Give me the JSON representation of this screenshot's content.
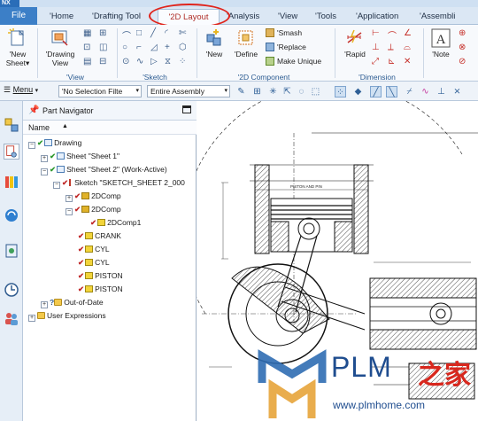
{
  "app": {
    "logo": "NX"
  },
  "tabs": [
    {
      "label": "File"
    },
    {
      "label": "'Home"
    },
    {
      "label": "'Drafting Tool"
    },
    {
      "label": "'2D Layout"
    },
    {
      "label": "'Analysis"
    },
    {
      "label": "'View"
    },
    {
      "label": "'Tools"
    },
    {
      "label": "'Application"
    },
    {
      "label": "'Assembli"
    }
  ],
  "ribbon": {
    "new_sheet": "'New\nSheet",
    "new_sheet_dropdown": "▾",
    "drawing_view": "'Drawing\nView",
    "new": "'New",
    "define": "'Define",
    "smash": "'Smash",
    "replace": "'Replace",
    "make_unique": "Make Unique",
    "rapid": "'Rapid",
    "note": "'Note",
    "groups": {
      "view": "'View",
      "sketch": "'Sketch",
      "component": "'2D Component",
      "dimension": "'Dimension"
    }
  },
  "cmdbar": {
    "menu": "Menu",
    "selection_filter": "'No Selection Filte",
    "assembly_scope": "Entire Assembly"
  },
  "navigator": {
    "title": "Part Navigator",
    "column_name": "Name",
    "nodes": [
      {
        "label": "Drawing"
      },
      {
        "label": "Sheet \"Sheet 1\""
      },
      {
        "label": "Sheet \"Sheet 2\" (Work-Active)"
      },
      {
        "label": "Sketch \"SKETCH_SHEET 2_000"
      },
      {
        "label": "2DComp"
      },
      {
        "label": "2DComp"
      },
      {
        "label": "2DComp1"
      },
      {
        "label": "CRANK"
      },
      {
        "label": "CYL"
      },
      {
        "label": "CYL"
      },
      {
        "label": "PISTON"
      },
      {
        "label": "PISTON"
      },
      {
        "label": "Out-of-Date"
      },
      {
        "label": "User Expressions"
      }
    ]
  },
  "drawing": {
    "label": "PISTON AND PIN"
  },
  "watermark": {
    "brand": "PLM",
    "brand_cn": "之家",
    "url": "www.plmhome.com"
  }
}
